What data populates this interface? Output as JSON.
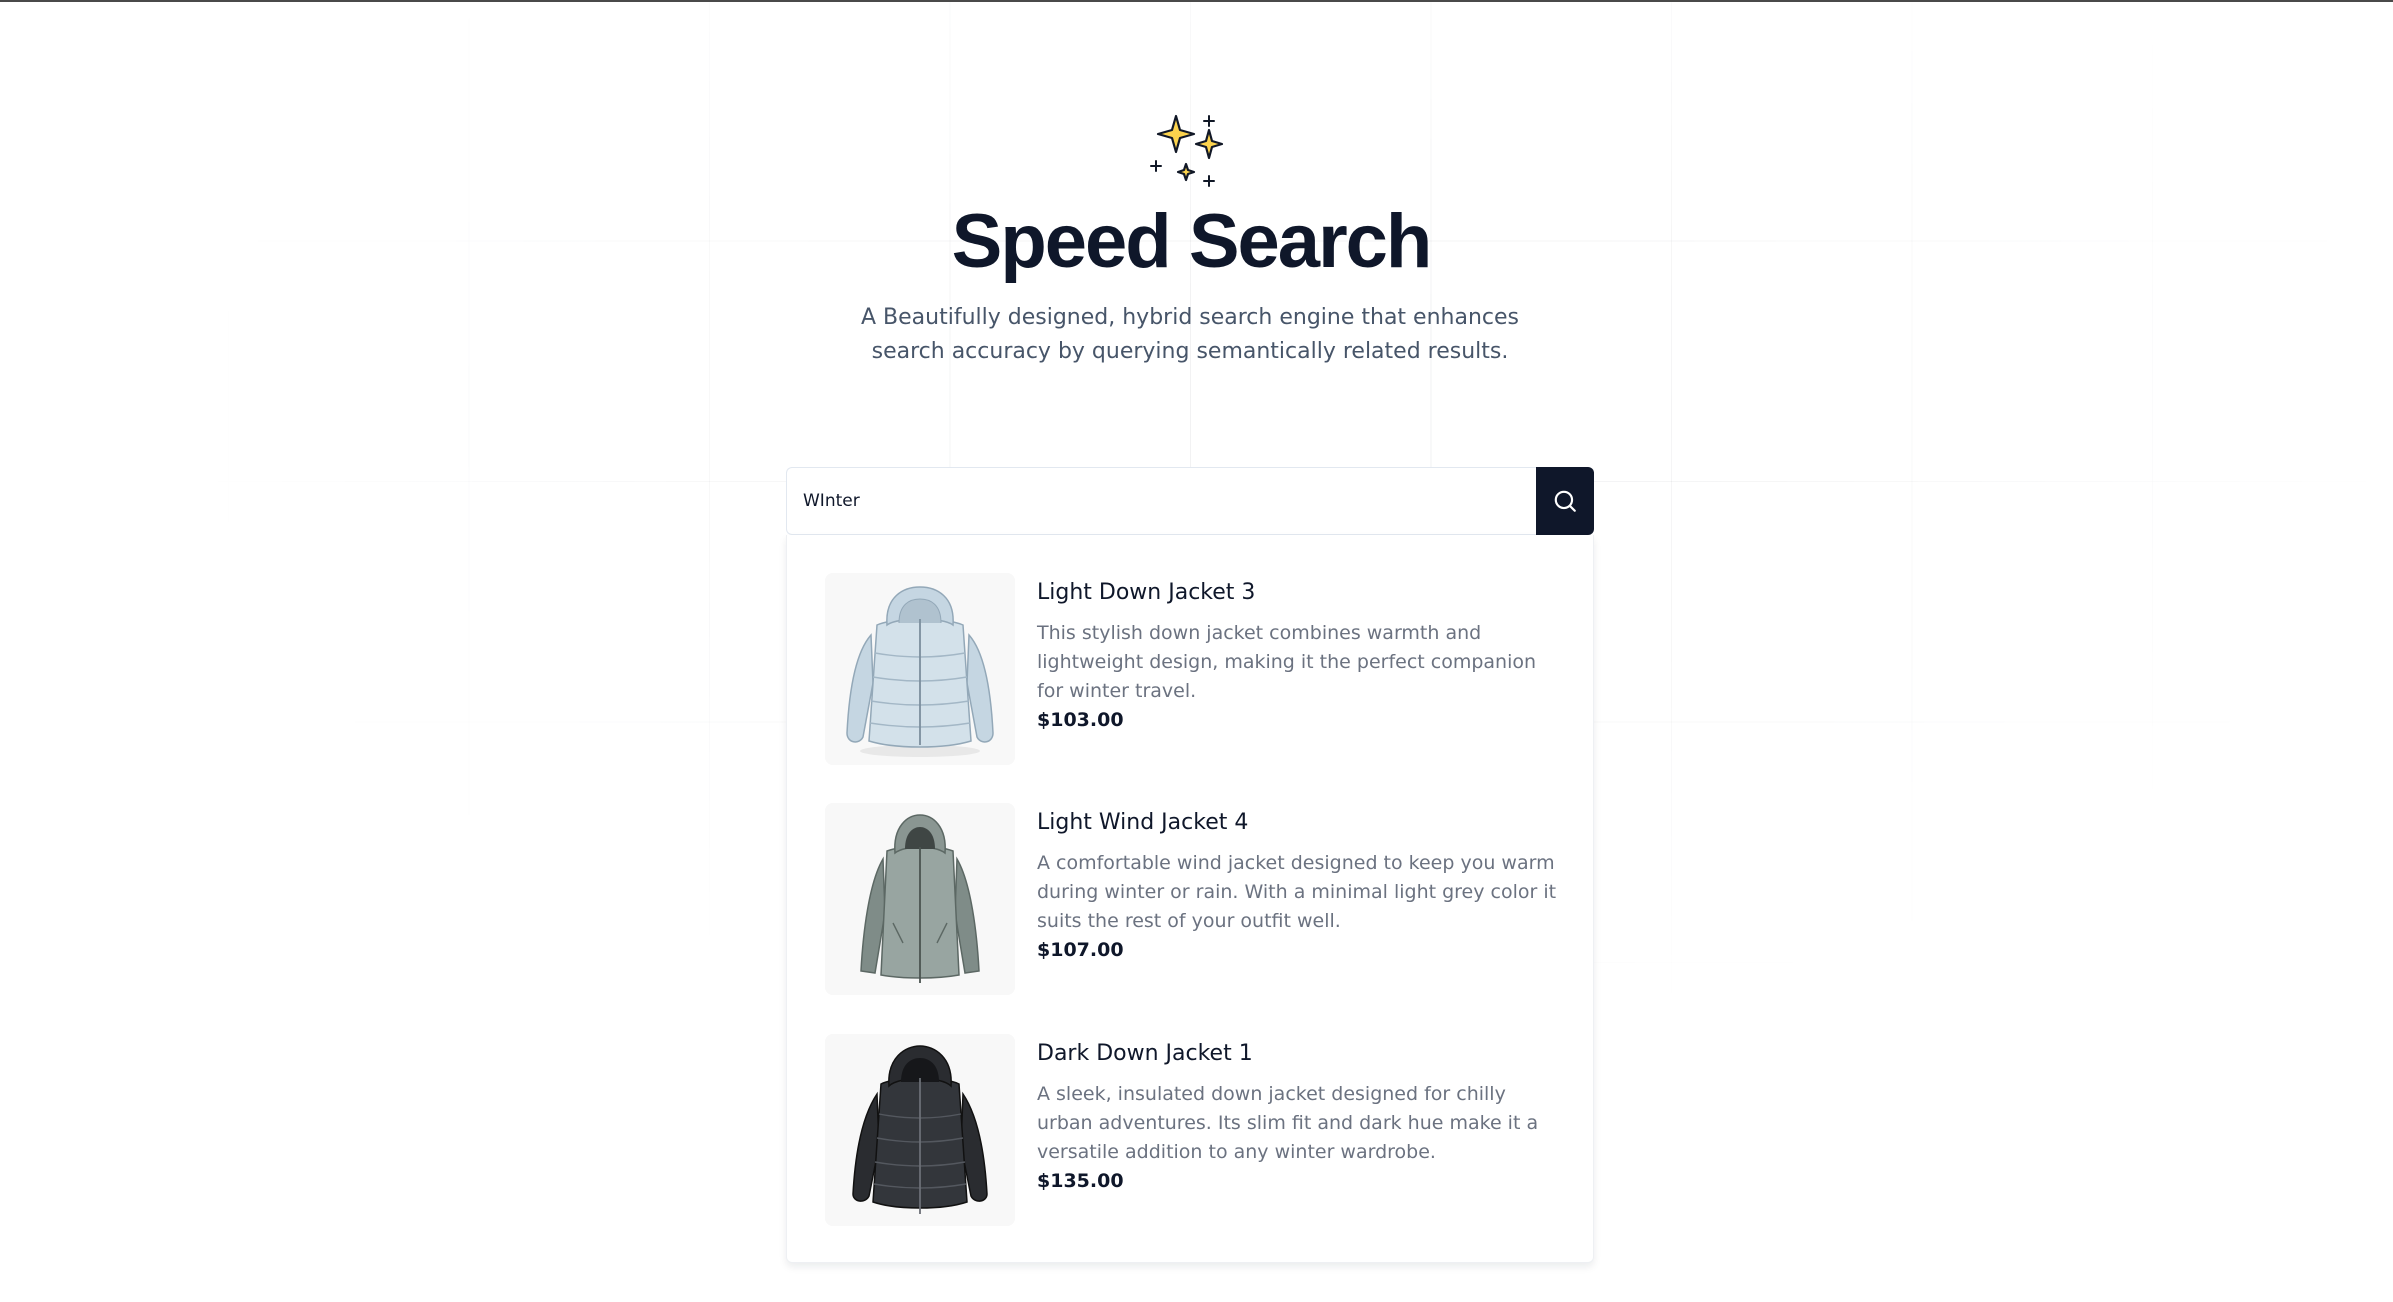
{
  "hero": {
    "title": "Speed Search",
    "subtitle": "A Beautifully designed, hybrid search engine that enhances search accuracy by querying semantically related results.",
    "icon": "sparkles-icon"
  },
  "search": {
    "value": "WInter",
    "button_icon": "search-icon"
  },
  "results": [
    {
      "title": "Light Down Jacket 3",
      "description": "This stylish down jacket combines warmth and lightweight design, making it the perfect companion for winter travel.",
      "price": "$103.00"
    },
    {
      "title": "Light Wind Jacket 4",
      "description": "A comfortable wind jacket designed to keep you warm during winter or rain. With a minimal light grey color it suits the rest of your outfit well.",
      "price": "$107.00"
    },
    {
      "title": "Dark Down Jacket 1",
      "description": "A sleek, insulated down jacket designed for chilly urban adventures. Its slim fit and dark hue make it a versatile addition to any winter wardrobe.",
      "price": "$135.00"
    }
  ],
  "colors": {
    "primary": "#0f172a",
    "muted": "#6b7280",
    "accent_star": "#fcd34d"
  }
}
